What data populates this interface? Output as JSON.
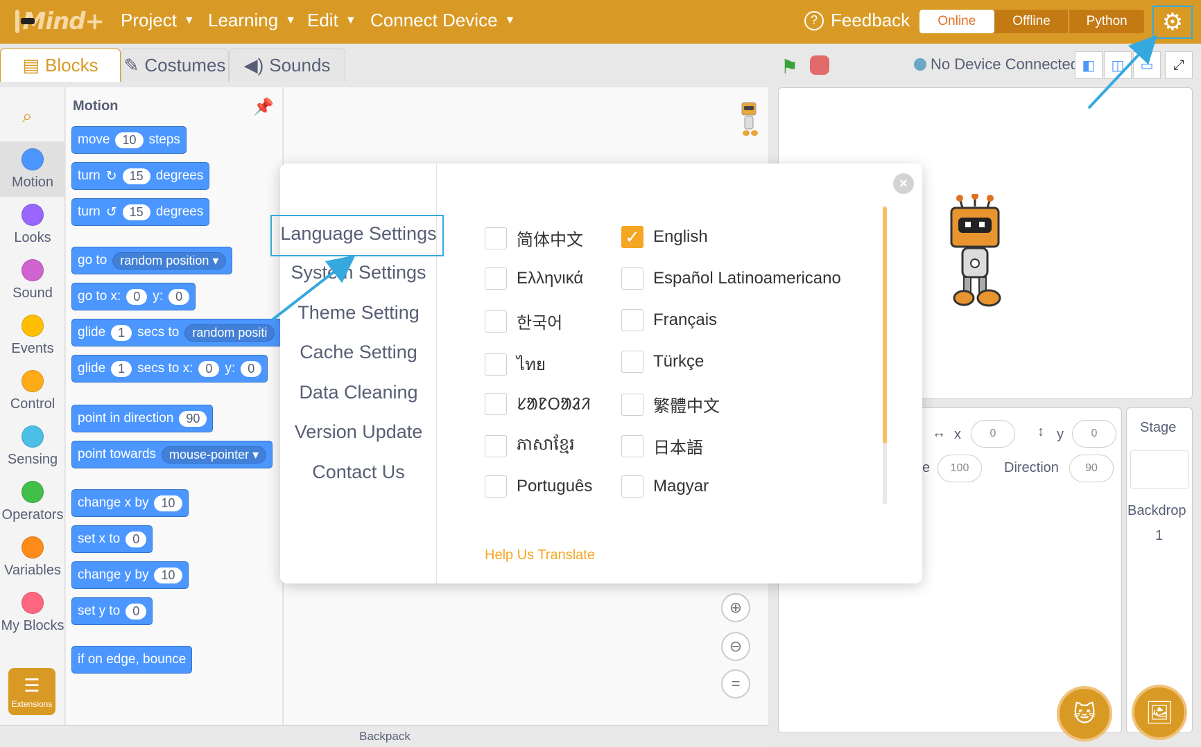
{
  "app": {
    "logo_text": "Mind+",
    "menu": [
      {
        "label": "Project"
      },
      {
        "label": "Learning"
      },
      {
        "label": "Edit"
      },
      {
        "label": "Connect Device"
      }
    ],
    "feedback": "Feedback",
    "modes": [
      "Online",
      "Offline",
      "Python"
    ],
    "active_mode": "Online"
  },
  "tabs": [
    "Blocks",
    "Costumes",
    "Sounds"
  ],
  "device_status": "No Device Connected",
  "categories": [
    {
      "label": "Motion",
      "color": "#4c97ff"
    },
    {
      "label": "Looks",
      "color": "#9966ff"
    },
    {
      "label": "Sound",
      "color": "#cf63cf"
    },
    {
      "label": "Events",
      "color": "#ffbf00"
    },
    {
      "label": "Control",
      "color": "#ffab19"
    },
    {
      "label": "Sensing",
      "color": "#4cbfe6"
    },
    {
      "label": "Operators",
      "color": "#40bf4a"
    },
    {
      "label": "Variables",
      "color": "#ff8c1a"
    },
    {
      "label": "My Blocks",
      "color": "#ff6680"
    }
  ],
  "extensions_label": "Extensions",
  "palette": {
    "title": "Motion",
    "blocks": {
      "move": {
        "a": "move",
        "v": "10",
        "b": "steps"
      },
      "turn_cw": {
        "a": "turn",
        "v": "15",
        "b": "degrees"
      },
      "turn_ccw": {
        "a": "turn",
        "v": "15",
        "b": "degrees"
      },
      "goto": {
        "a": "go to",
        "d": "random position"
      },
      "goto_xy": {
        "a": "go to x:",
        "v1": "0",
        "b": "y:",
        "v2": "0"
      },
      "glide": {
        "a": "glide",
        "v": "1",
        "b": "secs to",
        "d": "random positi"
      },
      "glide_xy": {
        "a": "glide",
        "v": "1",
        "b": "secs to x:",
        "v1": "0",
        "c": "y:",
        "v2": "0"
      },
      "point_dir": {
        "a": "point in direction",
        "v": "90"
      },
      "point_towards": {
        "a": "point towards",
        "d": "mouse-pointer"
      },
      "change_x": {
        "a": "change x by",
        "v": "10"
      },
      "set_x": {
        "a": "set x to",
        "v": "0"
      },
      "change_y": {
        "a": "change y by",
        "v": "10"
      },
      "set_y": {
        "a": "set y to",
        "v": "0"
      },
      "bounce": {
        "a": "if on edge, bounce"
      }
    }
  },
  "backpack": "Backpack",
  "sprite_panel": {
    "x_label": "x",
    "x_value": "0",
    "y_label": "y",
    "y_value": "0",
    "size_label_partial": "e",
    "size_value": "100",
    "direction_label": "Direction",
    "direction_value": "90"
  },
  "stage_panel": {
    "title": "Stage",
    "backdrop_label": "Backdrop",
    "backdrop_count": "1"
  },
  "dialog": {
    "sidebar": [
      "Language Settings",
      "System Settings",
      "Theme Setting",
      "Cache Setting",
      "Data Cleaning",
      "Version Update",
      "Contact Us"
    ],
    "languages_left": [
      "简体中文",
      "Ελληνικά",
      "한국어",
      "ไทย",
      "ᱥᱟᱱᱛᱟᱲᱤ",
      "ភាសាខ្មែរ",
      "Português"
    ],
    "languages_right": [
      "English",
      "Español Latinoamericano",
      "Français",
      "Türkçe",
      "繁體中文",
      "日本語",
      "Magyar"
    ],
    "selected_language": "English",
    "help_link": "Help Us Translate"
  },
  "icons": {
    "gear": "gear-icon",
    "flag": "green-flag-icon",
    "stop": "stop-icon",
    "search": "search-icon",
    "close": "close-icon"
  },
  "colors": {
    "brand": "#d99a25",
    "accent": "#f5a623",
    "highlight": "#35a8e0"
  }
}
